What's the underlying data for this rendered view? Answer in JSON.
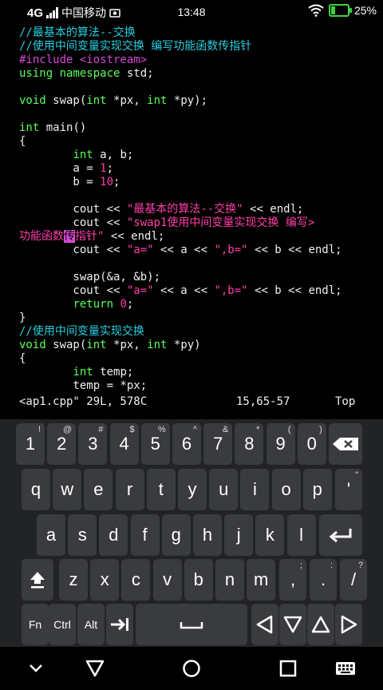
{
  "status_bar": {
    "network": "4G",
    "carrier": "中国移动",
    "time": "13:48",
    "battery": "25%"
  },
  "editor": {
    "lines": [
      "//最基本的算法--交换",
      "//使用中间变量实现交换 编写功能函数传指针",
      "#include <iostream>",
      "using namespace std;",
      "",
      "void swap(int *px, int *py);",
      "",
      "int main()",
      "{",
      "        int a, b;",
      "        a = 1;",
      "        b = 10;",
      "",
      "        cout << \"最基本的算法--交换\" << endl;",
      "        cout << \"swap1使用中间变量实现交换 编写>",
      "功能函数传指针\" << endl;",
      "        cout << \"a=\" << a << \",b=\" << b << endl;",
      "",
      "        swap(&a, &b);",
      "        cout << \"a=\" << a << \",b=\" << b << endl;",
      "        return 0;",
      "}",
      "//使用中间变量实现交换",
      "void swap(int *px, int *py)",
      "{",
      "        int temp;",
      "        temp = *px;"
    ],
    "status_line": {
      "file": "<ap1.cpp\" 29L, 578C",
      "position": "15,65-57",
      "scroll": "Top"
    }
  },
  "keyboard": {
    "row_numbers": [
      {
        "main": "1",
        "sup": "!"
      },
      {
        "main": "2",
        "sup": "@"
      },
      {
        "main": "3",
        "sup": "#"
      },
      {
        "main": "4",
        "sup": "$"
      },
      {
        "main": "5",
        "sup": "%"
      },
      {
        "main": "6",
        "sup": "^"
      },
      {
        "main": "7",
        "sup": "&"
      },
      {
        "main": "8",
        "sup": "*"
      },
      {
        "main": "9",
        "sup": "("
      },
      {
        "main": "0",
        "sup": ")"
      }
    ],
    "row_q": [
      "q",
      "w",
      "e",
      "r",
      "t",
      "y",
      "u",
      "i",
      "o",
      "p"
    ],
    "row_q_extra": {
      "main": "'",
      "sup": "\""
    },
    "row_a": [
      "a",
      "s",
      "d",
      "f",
      "g",
      "h",
      "j",
      "k",
      "l"
    ],
    "row_z": [
      "z",
      "x",
      "c",
      "v",
      "b",
      "n",
      "m"
    ],
    "row_z_extra": [
      {
        "main": ",",
        "sup": ";"
      },
      {
        "main": ".",
        "sup": ":"
      },
      {
        "main": "/",
        "sup": "?"
      }
    ],
    "modifiers": {
      "fn": "Fn",
      "ctrl": "Ctrl",
      "alt": "Alt"
    }
  },
  "colors": {
    "comment": "#27cfe0",
    "preprocessor": "#d54ad5",
    "keyword": "#5aff5a",
    "string": "#ff3ea8",
    "battery": "#3fd43f",
    "key_bg": "#3a3b3e",
    "keyboard_bg": "#222325"
  }
}
